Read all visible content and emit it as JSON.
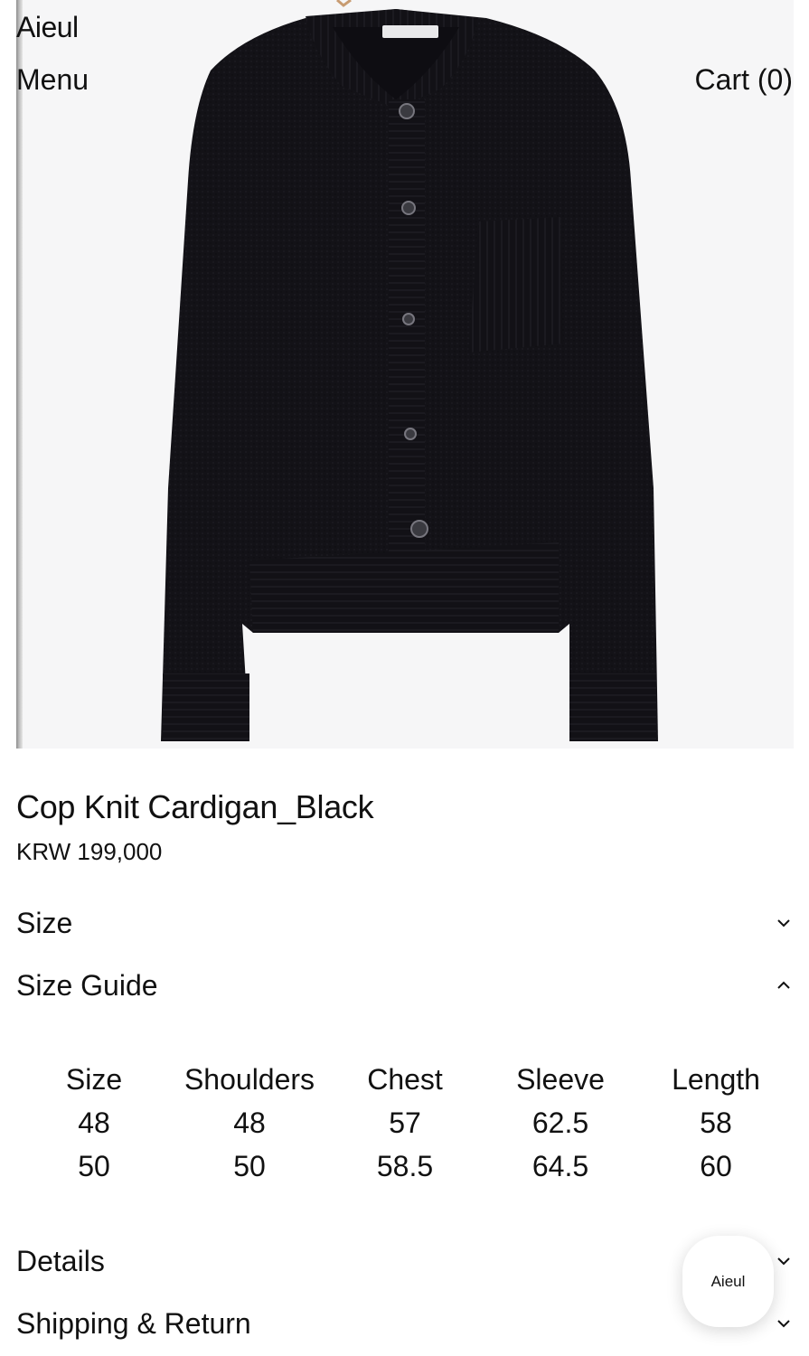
{
  "header": {
    "brand": "Aieul",
    "menu_label": "Menu",
    "cart_label": "Cart (0)"
  },
  "hero": {
    "image_alt": "Black knit cardigan on hanger",
    "garment_color": "#131217",
    "background_color": "#f6f6f7"
  },
  "product": {
    "title": "Cop Knit Cardigan_Black",
    "price": "KRW 199,000"
  },
  "accordions": {
    "size": {
      "label": "Size",
      "state": "collapsed",
      "icon": "chevron-down-icon"
    },
    "size_guide": {
      "label": "Size Guide",
      "state": "expanded",
      "icon": "chevron-up-icon"
    },
    "details": {
      "label": "Details",
      "state": "collapsed",
      "icon": "chevron-down-icon"
    },
    "shipping": {
      "label": "Shipping & Return",
      "state": "collapsed",
      "icon": "chevron-down-icon"
    }
  },
  "size_guide": {
    "headers": [
      "Size",
      "Shoulders",
      "Chest",
      "Sleeve",
      "Length"
    ],
    "rows": [
      [
        "48",
        "48",
        "57",
        "62.5",
        "58"
      ],
      [
        "50",
        "50",
        "58.5",
        "64.5",
        "60"
      ]
    ]
  },
  "chat": {
    "label": "Aieul"
  }
}
